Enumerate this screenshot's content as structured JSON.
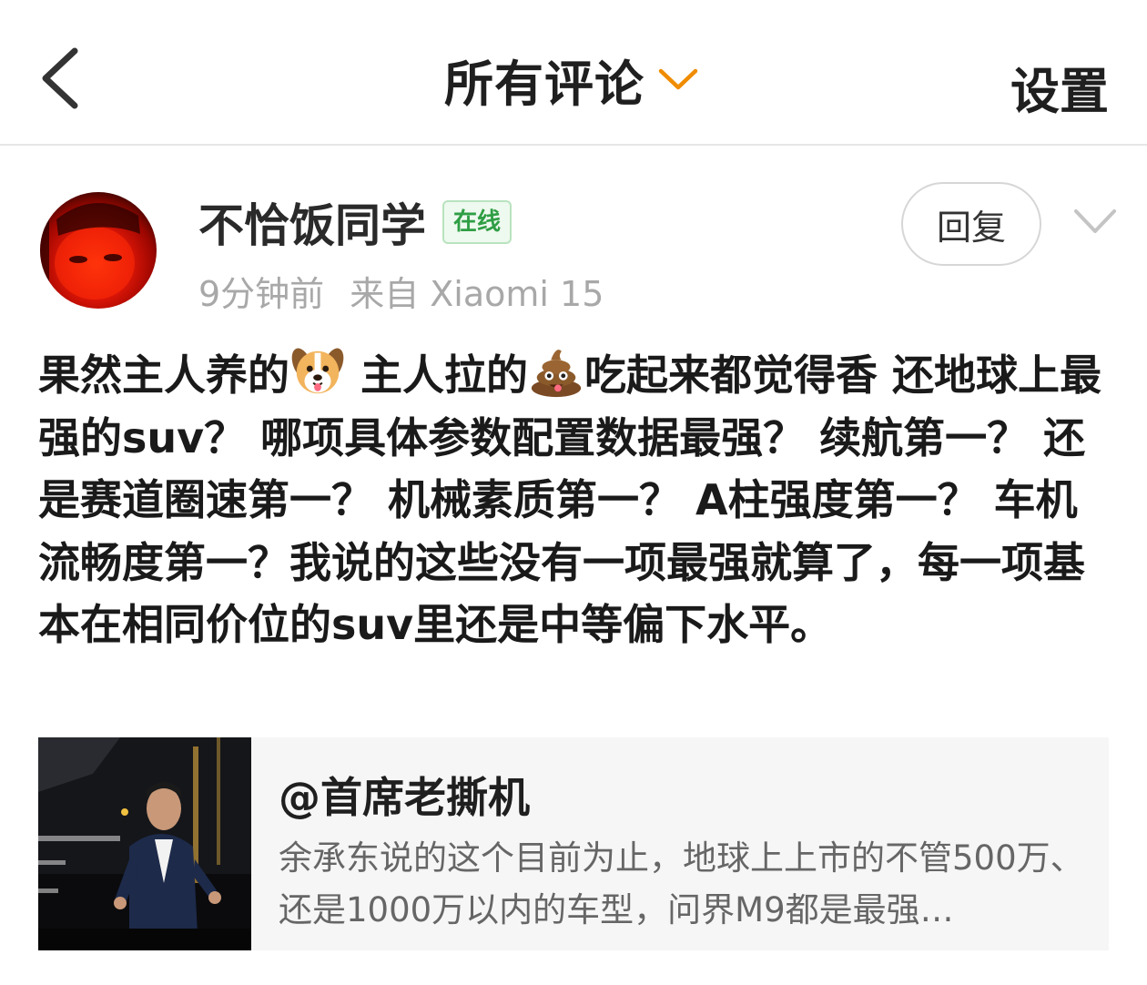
{
  "header": {
    "title": "所有评论",
    "settings_label": "设置",
    "accent_color": "#f08c00"
  },
  "comment": {
    "username": "不恰饭同学",
    "online_badge": "在线",
    "time": "9分钟前",
    "source": "来自 Xiaomi 15",
    "reply_label": "回复",
    "body_parts": {
      "p1": "果然主人养的",
      "p2": " 主人拉的",
      "p3": "吃起来都觉得香  还地球上最强的suv？ 哪项具体参数配置数据最强？ 续航第一？ 还是赛道圈速第一？ 机械素质第一？ A柱强度第一？ 车机流畅度第一？我说的这些没有一项最强就算了，每一项基本在相同价位的suv里还是中等偏下水平。"
    },
    "emojis": [
      "dog-face-emoji",
      "pile-of-poo-emoji"
    ]
  },
  "quote": {
    "author": "@首席老撕机",
    "text": "余承东说的这个目前为止，地球上上市的不管500万、还是1000万以内的车型，问界M9都是最强…"
  },
  "icons": {
    "back": "back-chevron-icon",
    "title_dropdown": "chevron-down-icon",
    "more": "chevron-down-icon"
  }
}
